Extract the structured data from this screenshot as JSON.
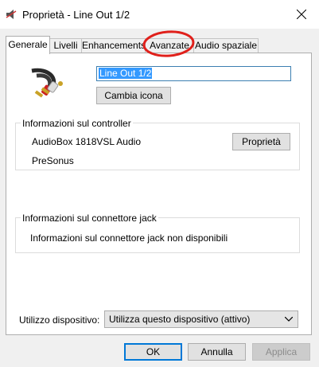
{
  "window": {
    "title": "Proprietà - Line Out 1/2",
    "close_icon": "close-icon"
  },
  "tabs": [
    {
      "label": "Generale",
      "active": true
    },
    {
      "label": "Livelli",
      "active": false
    },
    {
      "label": "Enhancements",
      "active": false
    },
    {
      "label": "Avanzate",
      "active": false
    },
    {
      "label": "Audio spaziale",
      "active": false
    }
  ],
  "device": {
    "icon": "rca-cable-icon",
    "name_value": "Line Out 1/2",
    "change_icon_label": "Cambia icona"
  },
  "controller": {
    "legend": "Informazioni sul controller",
    "name": "AudioBox 1818VSL Audio",
    "vendor": "PreSonus",
    "properties_label": "Proprietà"
  },
  "jack": {
    "legend": "Informazioni sul connettore jack",
    "message": "Informazioni sul connettore jack non disponibili"
  },
  "usage": {
    "label": "Utilizzo dispositivo:",
    "selected": "Utilizza questo dispositivo (attivo)"
  },
  "footer": {
    "ok": "OK",
    "cancel": "Annulla",
    "apply": "Applica",
    "apply_enabled": false
  },
  "annotation": {
    "color": "#e0201b",
    "target": "Avanzate"
  }
}
